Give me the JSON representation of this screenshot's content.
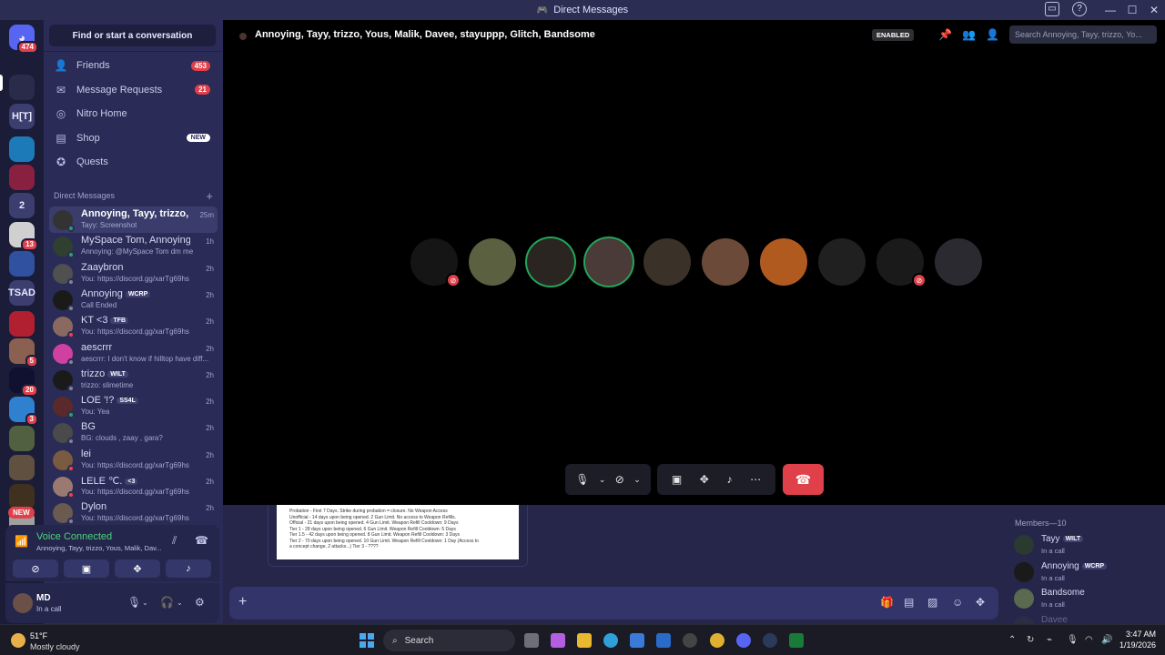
{
  "window": {
    "title": "Direct Messages"
  },
  "rail": {
    "home_badge": "474",
    "servers": [
      {
        "label": "",
        "badge": ""
      },
      {
        "label": "H[T]",
        "badge": ""
      },
      {
        "label": "",
        "badge": ""
      },
      {
        "label": "",
        "badge": ""
      },
      {
        "label": "2",
        "badge": ""
      },
      {
        "label": "",
        "badge": "13"
      },
      {
        "label": "",
        "badge": ""
      },
      {
        "label": "TSAD",
        "badge": ""
      },
      {
        "label": "",
        "badge": ""
      },
      {
        "label": "",
        "badge": "5"
      },
      {
        "label": "",
        "badge": "20"
      },
      {
        "label": "",
        "badge": "3"
      },
      {
        "label": "",
        "badge": ""
      },
      {
        "label": "",
        "badge": ""
      },
      {
        "label": "",
        "badge": ""
      },
      {
        "label": "",
        "badge": ""
      }
    ],
    "new_label": "NEW"
  },
  "sidebar": {
    "search_label": "Find or start a conversation",
    "nav": [
      {
        "label": "Friends",
        "badge": "453"
      },
      {
        "label": "Message Requests",
        "badge": "21"
      },
      {
        "label": "Nitro Home",
        "badge": ""
      },
      {
        "label": "Shop",
        "badge": "NEW"
      },
      {
        "label": "Quests",
        "badge": ""
      }
    ],
    "dm_header": "Direct Messages",
    "dms": [
      {
        "name": "Annoying, Tayy, trizzo, Y...",
        "sub": "Tayy: Screenshot",
        "time": "25m",
        "tag": ""
      },
      {
        "name": "MySpace Tom, Annoying",
        "sub": "Annoying: @MySpace Tom dm me",
        "time": "1h",
        "tag": ""
      },
      {
        "name": "Zaaybron",
        "sub": "You: https://discord.gg/xarTg69hs",
        "time": "2h",
        "tag": ""
      },
      {
        "name": "Annoying",
        "sub": "Call Ended",
        "time": "2h",
        "tag": "WCRP"
      },
      {
        "name": "KT <3",
        "sub": "You: https://discord.gg/xarTg69hs",
        "time": "2h",
        "tag": "TFB"
      },
      {
        "name": "aescrrr",
        "sub": "aescrrr: I don't know if hilltop have diff...",
        "time": "2h",
        "tag": ""
      },
      {
        "name": "trizzo",
        "sub": "trizzo: slimetime",
        "time": "2h",
        "tag": "WILT"
      },
      {
        "name": "LOE '!?",
        "sub": "You: Yea",
        "time": "2h",
        "tag": "SS4L"
      },
      {
        "name": "BG",
        "sub": "BG: clouds , zaay , gara?",
        "time": "2h",
        "tag": ""
      },
      {
        "name": "lei",
        "sub": "You: https://discord.gg/xarTg69hs",
        "time": "2h",
        "tag": ""
      },
      {
        "name": "LELE ℃.",
        "sub": "You: https://discord.gg/xarTg69hs",
        "time": "2h",
        "tag": "<3"
      },
      {
        "name": "Dylon",
        "sub": "You: https://discord.gg/xarTg69hs",
        "time": "2h",
        "tag": ""
      }
    ]
  },
  "voice": {
    "title": "Voice Connected",
    "sub": "Annoying, Tayy, trizzo, Yous, Malik, Dav..."
  },
  "user": {
    "name": "MD",
    "status": "In a call"
  },
  "call": {
    "title": "Annoying, Tayy, trizzo, Yous, Malik, Davee, stayuppp, Glitch, Bandsome",
    "enabled_label": "ENABLED",
    "search_placeholder": "Search Annoying, Tayy, trizzo, Yo...",
    "participants": [
      {
        "color": "#151515",
        "speaking": false,
        "muted": true
      },
      {
        "color": "#5a6040",
        "speaking": false,
        "muted": false
      },
      {
        "color": "#2a2520",
        "speaking": true,
        "muted": false
      },
      {
        "color": "#4a3a38",
        "speaking": true,
        "muted": false
      },
      {
        "color": "#3a3228",
        "speaking": false,
        "muted": false
      },
      {
        "color": "#6b4a3a",
        "speaking": false,
        "muted": false
      },
      {
        "color": "#b05a20",
        "speaking": false,
        "muted": false
      },
      {
        "color": "#202020",
        "speaking": false,
        "muted": false
      },
      {
        "color": "#1a1a1a",
        "speaking": false,
        "muted": true
      },
      {
        "color": "#2a2a30",
        "speaking": false,
        "muted": false
      }
    ]
  },
  "chat": {
    "image_lines": [
      "Probation - First 7 Days. Strike during probation = closure. No Weapon Access",
      "Unofficial - 14 days upon being opened. 2 Gun Limit. No access to Weapon Refills.",
      "Official - 21 days upon being opened. 4 Gun Limit. Weapon Refill Cooldown: 9 Days",
      "Tier 1 - 28 days upon being opened. 6 Gun Limit. Weapon Refill Cooldown: 5 Days",
      "Tier 1.5 - 42 days upon being opened. 8 Gun Limit. Weapon Refill Cooldown: 3 Days",
      "Tier 2 - 70 days upon being opened. 10 Gun Limit. Weapon Refill Cooldown: 1 Day (Access to",
      "a concept change, 2 attacks...) Tier 3 - ????"
    ]
  },
  "members": {
    "header": "Members—10",
    "list": [
      {
        "name": "Tayy",
        "tag": "WILT",
        "status": "In a call"
      },
      {
        "name": "Annoying",
        "tag": "WCRP",
        "status": "In a call"
      },
      {
        "name": "Bandsome",
        "tag": "",
        "status": "In a call"
      },
      {
        "name": "Davee",
        "tag": "",
        "status": ""
      }
    ]
  },
  "taskbar": {
    "weather_temp": "51°F",
    "weather_desc": "Mostly cloudy",
    "search_label": "Search",
    "time": "3:47 AM",
    "date": "1/19/2026"
  }
}
